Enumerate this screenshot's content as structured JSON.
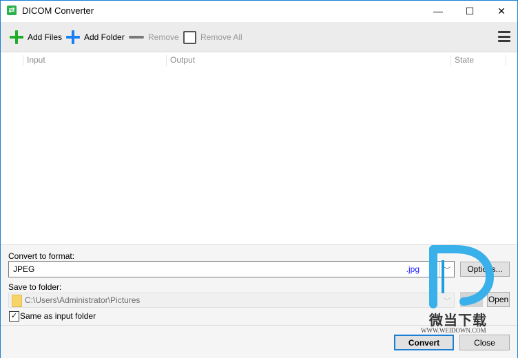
{
  "window": {
    "title": "DICOM Converter",
    "controls": {
      "minimize": "—",
      "maximize": "☐",
      "close": "✕"
    }
  },
  "toolbar": {
    "add_files": "Add Files",
    "add_folder": "Add Folder",
    "remove": "Remove",
    "remove_all": "Remove All",
    "colors": {
      "add_files": "#1fae2c",
      "add_folder": "#1a7ff0"
    }
  },
  "list": {
    "columns": [
      "Input",
      "Output",
      "State"
    ],
    "rows": []
  },
  "settings": {
    "format_label": "Convert to format:",
    "format_value": "JPEG",
    "format_ext": ".jpg",
    "options_button": "Options...",
    "folder_label": "Save to folder:",
    "folder_path": "C:\\Users\\Administrator\\Pictures",
    "browse_button": "...",
    "open_button": "Open",
    "same_folder_label": "Same as input folder",
    "same_folder_checked": true,
    "check_glyph": "✓"
  },
  "footer": {
    "convert_button": "Convert",
    "close_button": "Close"
  },
  "watermark": {
    "text": "微当下载",
    "url": "WWW.WEIDOWN.COM"
  }
}
